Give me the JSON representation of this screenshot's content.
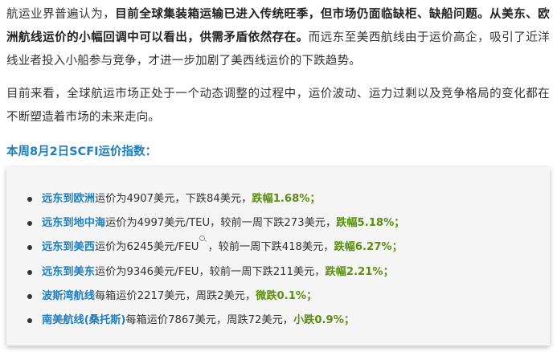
{
  "paragraph1": {
    "s1": "航运业界普遍认为，",
    "s2": "目前全球集装箱运输已进入传统旺季，但市场仍面临缺柜、缺船问题。从美东、欧洲航线运价的小幅回调中可以看出，供需矛盾依然存在。",
    "s3": "而远东至美西航线由于运价高企，吸引了近洋线业者投入小船参与竞争，才进一步加剧了美西线运价的下跌趋势。"
  },
  "paragraph2": "目前来看，全球航运市场正处于一个动态调整的过程中，运价波动、运力过剩以及竞争格局的变化都在不断塑造着市场的未来走向。",
  "section_title": "本周8月2日SCFI运价指数：",
  "rates": [
    {
      "route": "远东到欧洲",
      "text": "运价为4907美元，下跌84美元，",
      "change": "跌幅1.68%；"
    },
    {
      "route": "远东到地中海",
      "text": "运价为4997美元/TEU，较前一周下跌273美元，",
      "change": "跌幅5.18%；"
    },
    {
      "route": "远东到美西",
      "text_a": "运价为6245美元/FEU",
      "text_b": "，较前一周下跌418美元，",
      "change": "跌幅6.27%；"
    },
    {
      "route": "远东到美东",
      "text": "运价为9346美元/FEU，较前一周下跌211美元，",
      "change": "跌幅2.21%；"
    },
    {
      "route": "波斯湾航线",
      "text": "每箱运价2217美元，周跌2美元，",
      "change": "微跌0.1%；"
    },
    {
      "route": "南美航线(桑托斯)",
      "text": "每箱运价7867美元，周跌72美元，",
      "change": "小跌0.9%；"
    }
  ]
}
